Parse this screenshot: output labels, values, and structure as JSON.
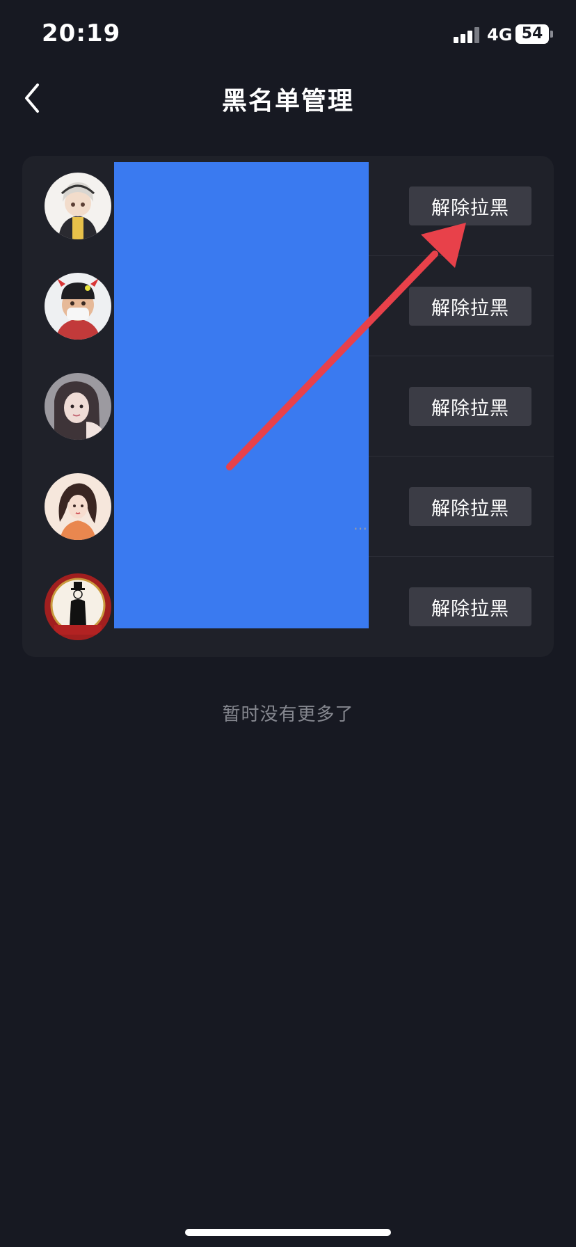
{
  "status_bar": {
    "time": "20:19",
    "network": "4G",
    "battery": "54"
  },
  "header": {
    "back_icon": "chevron-left-icon",
    "title": "黑名单管理"
  },
  "blocked_list": [
    {
      "avatar": "avatar-cartoon-boy",
      "action_label": "解除拉黑"
    },
    {
      "avatar": "avatar-cartoon-mask-boy",
      "action_label": "解除拉黑"
    },
    {
      "avatar": "avatar-girl-photo",
      "action_label": "解除拉黑"
    },
    {
      "avatar": "avatar-illustrated-girl",
      "action_label": "解除拉黑"
    },
    {
      "avatar": "avatar-red-badge",
      "action_label": "解除拉黑"
    }
  ],
  "row_ellipsis": "…",
  "list_end_text": "暂时没有更多了",
  "colors": {
    "background": "#171922",
    "card": "#1f2129",
    "button": "#3b3c45",
    "redaction": "#3a7af0",
    "annotation_arrow": "#e8414a"
  }
}
